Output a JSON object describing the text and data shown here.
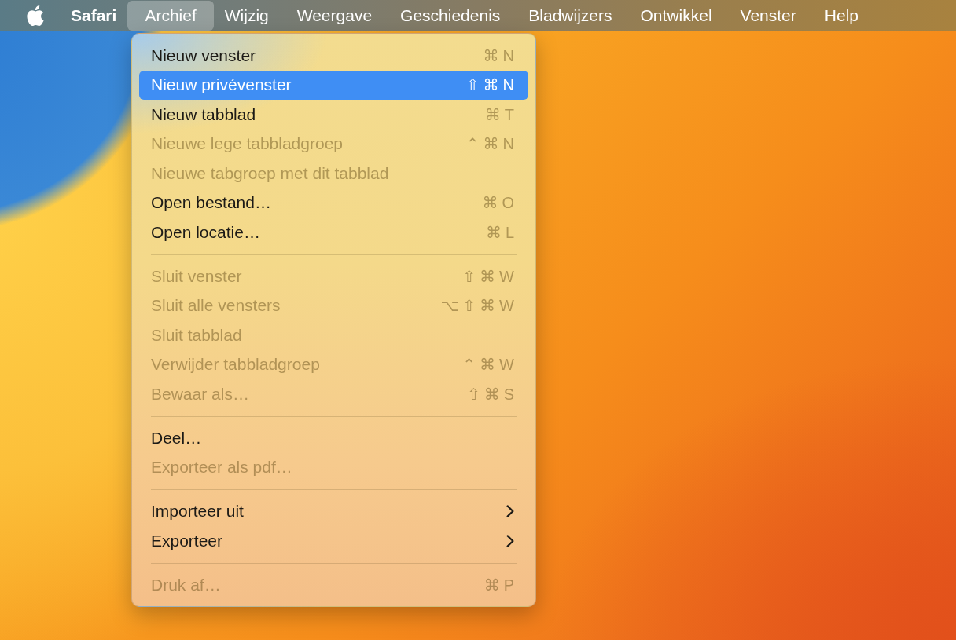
{
  "menu_bar": {
    "app_name": "Safari",
    "menus": [
      {
        "label": "Archief",
        "selected": true
      },
      {
        "label": "Wijzig",
        "selected": false
      },
      {
        "label": "Weergave",
        "selected": false
      },
      {
        "label": "Geschiedenis",
        "selected": false
      },
      {
        "label": "Bladwijzers",
        "selected": false
      },
      {
        "label": "Ontwikkel",
        "selected": false
      },
      {
        "label": "Venster",
        "selected": false
      },
      {
        "label": "Help",
        "selected": false
      }
    ]
  },
  "menu": {
    "groups": [
      {
        "items": [
          {
            "kind": "command",
            "label": "Nieuw venster",
            "shortcut": "⌘N",
            "disabled": false,
            "selected": false
          },
          {
            "kind": "command",
            "label": "Nieuw privévenster",
            "shortcut": "⇧⌘N",
            "disabled": false,
            "selected": true
          },
          {
            "kind": "command",
            "label": "Nieuw tabblad",
            "shortcut": "⌘T",
            "disabled": false,
            "selected": false
          },
          {
            "kind": "command",
            "label": "Nieuwe lege tabbladgroep",
            "shortcut": "⌃⌘N",
            "disabled": true,
            "selected": false
          },
          {
            "kind": "command",
            "label": "Nieuwe tabgroep met dit tabblad",
            "disabled": true,
            "selected": false
          },
          {
            "kind": "command",
            "label": "Open bestand…",
            "shortcut": "⌘O",
            "disabled": false,
            "selected": false
          },
          {
            "kind": "command",
            "label": "Open locatie…",
            "shortcut": "⌘L",
            "disabled": false,
            "selected": false
          }
        ]
      },
      {
        "items": [
          {
            "kind": "command",
            "label": "Sluit venster",
            "shortcut": "⇧⌘W",
            "disabled": true,
            "selected": false
          },
          {
            "kind": "command",
            "label": "Sluit alle vensters",
            "shortcut": "⌥⇧⌘W",
            "disabled": true,
            "selected": false
          },
          {
            "kind": "command",
            "label": "Sluit tabblad",
            "disabled": true,
            "selected": false
          },
          {
            "kind": "command",
            "label": "Verwijder tabbladgroep",
            "shortcut": "⌃⌘W",
            "disabled": true,
            "selected": false
          },
          {
            "kind": "command",
            "label": "Bewaar als…",
            "shortcut": "⇧⌘S",
            "disabled": true,
            "selected": false
          }
        ]
      },
      {
        "items": [
          {
            "kind": "command",
            "label": "Deel…",
            "disabled": false,
            "selected": false
          },
          {
            "kind": "command",
            "label": "Exporteer als pdf…",
            "disabled": true,
            "selected": false
          }
        ]
      },
      {
        "items": [
          {
            "kind": "submenu",
            "label": "Importeer uit",
            "disabled": false,
            "selected": false
          },
          {
            "kind": "submenu",
            "label": "Exporteer",
            "disabled": false,
            "selected": false
          }
        ]
      },
      {
        "items": [
          {
            "kind": "command",
            "label": "Druk af…",
            "shortcut": "⌘P",
            "disabled": true,
            "selected": false
          }
        ]
      }
    ]
  }
}
